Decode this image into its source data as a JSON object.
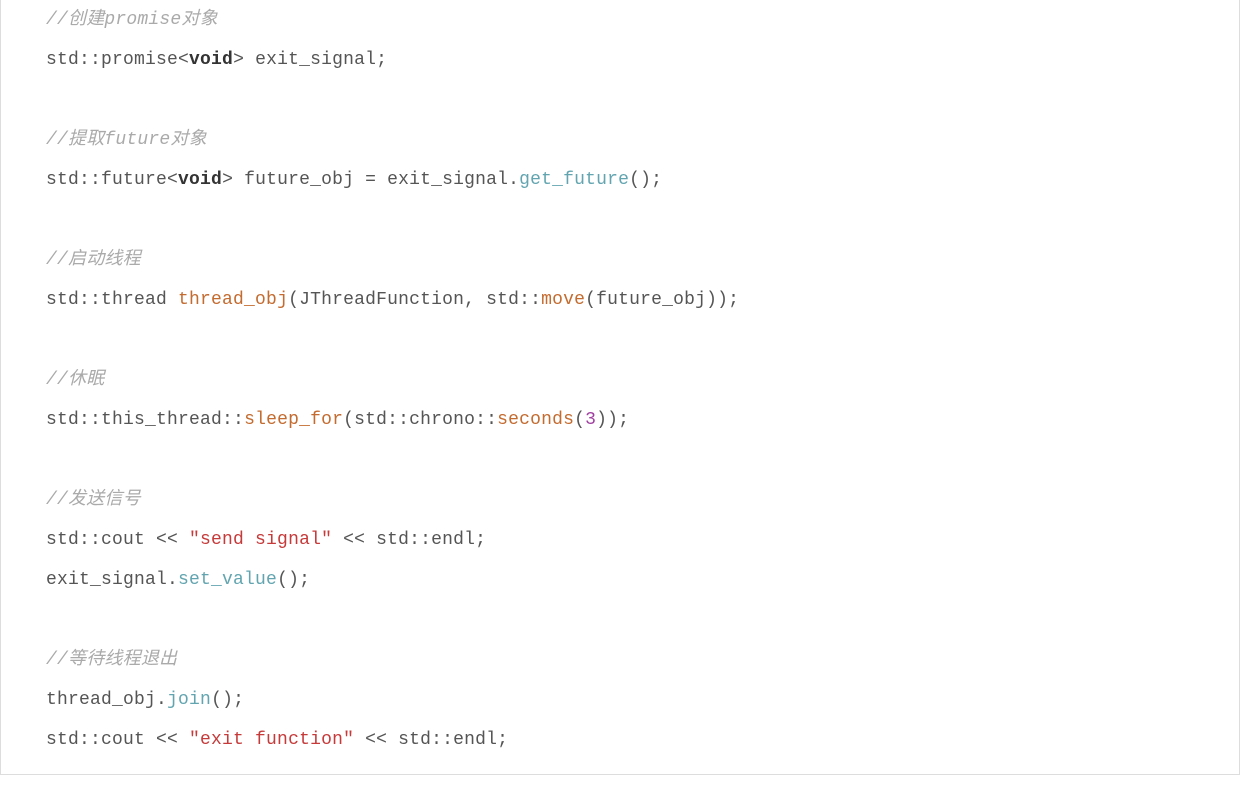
{
  "code": {
    "indent": "   ",
    "lines": [
      {
        "tokens": [
          {
            "cls": "comment",
            "t": "//创建promise对象"
          }
        ]
      },
      {
        "tokens": [
          {
            "t": "std::promise<"
          },
          {
            "cls": "keyword",
            "t": "void"
          },
          {
            "t": "> exit_signal;"
          }
        ]
      },
      {
        "blank": true
      },
      {
        "tokens": [
          {
            "cls": "comment",
            "t": "//提取future对象"
          }
        ]
      },
      {
        "tokens": [
          {
            "t": "std::future<"
          },
          {
            "cls": "keyword",
            "t": "void"
          },
          {
            "t": "> future_obj = exit_signal."
          },
          {
            "cls": "fn-teal",
            "t": "get_future"
          },
          {
            "t": "();"
          }
        ]
      },
      {
        "blank": true
      },
      {
        "tokens": [
          {
            "cls": "comment",
            "t": "//启动线程"
          }
        ]
      },
      {
        "tokens": [
          {
            "t": "std::thread "
          },
          {
            "cls": "fn-brown",
            "t": "thread_obj"
          },
          {
            "t": "(JThreadFunction, std::"
          },
          {
            "cls": "fn-brown",
            "t": "move"
          },
          {
            "t": "(future_obj));"
          }
        ]
      },
      {
        "blank": true
      },
      {
        "tokens": [
          {
            "cls": "comment",
            "t": "//休眠"
          }
        ]
      },
      {
        "tokens": [
          {
            "t": "std::this_thread::"
          },
          {
            "cls": "fn-brown",
            "t": "sleep_for"
          },
          {
            "t": "(std::chrono::"
          },
          {
            "cls": "fn-brown",
            "t": "seconds"
          },
          {
            "t": "("
          },
          {
            "cls": "num",
            "t": "3"
          },
          {
            "t": "));"
          }
        ]
      },
      {
        "blank": true
      },
      {
        "tokens": [
          {
            "cls": "comment",
            "t": "//发送信号"
          }
        ]
      },
      {
        "tokens": [
          {
            "t": "std::cout << "
          },
          {
            "cls": "str",
            "t": "\"send signal\""
          },
          {
            "t": " << std::endl;"
          }
        ]
      },
      {
        "tokens": [
          {
            "t": "exit_signal."
          },
          {
            "cls": "fn-teal",
            "t": "set_value"
          },
          {
            "t": "();"
          }
        ]
      },
      {
        "blank": true
      },
      {
        "tokens": [
          {
            "cls": "comment",
            "t": "//等待线程退出"
          }
        ]
      },
      {
        "tokens": [
          {
            "t": "thread_obj."
          },
          {
            "cls": "fn-teal",
            "t": "join"
          },
          {
            "t": "();"
          }
        ]
      },
      {
        "tokens": [
          {
            "t": "std::cout << "
          },
          {
            "cls": "str",
            "t": "\"exit function\""
          },
          {
            "t": " << std::endl;"
          }
        ]
      }
    ]
  }
}
